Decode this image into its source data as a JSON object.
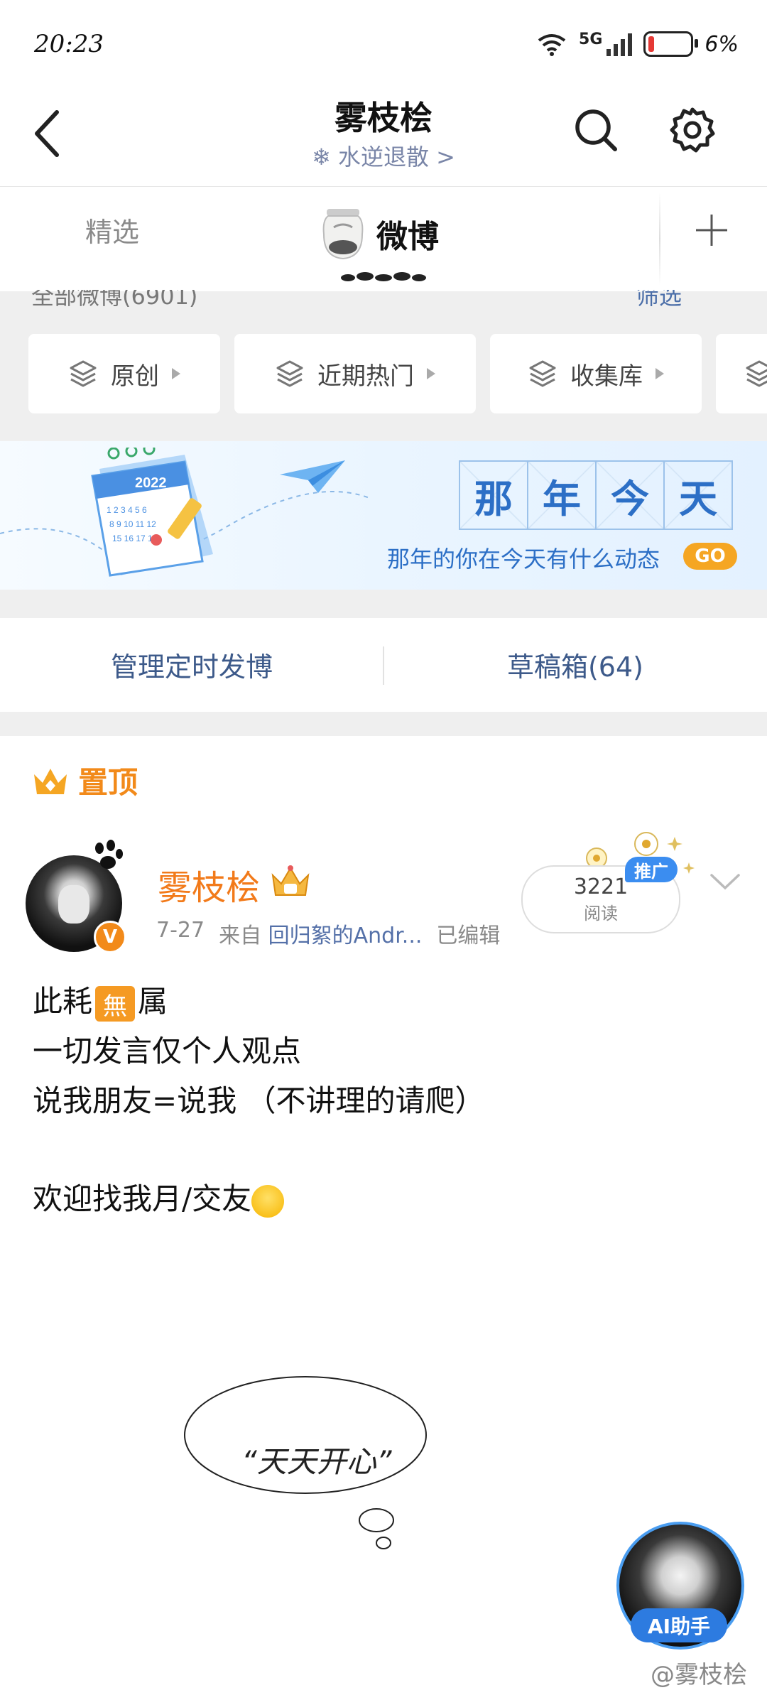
{
  "status": {
    "time": "20:23",
    "network": "5G",
    "battery": "6%",
    "battery_fraction": 0.06
  },
  "header": {
    "title": "雾枝桧",
    "subtitle": "❄ 水逆退散 >"
  },
  "tabs": [
    {
      "label": "精选",
      "selected": false
    },
    {
      "label": "微博",
      "selected": true
    }
  ],
  "filter": {
    "peek_left": "全部微博(6901)",
    "peek_right": "筛选"
  },
  "chips": [
    "原创",
    "近期热门",
    "收集库"
  ],
  "banner": {
    "title_chars": [
      "那",
      "年",
      "今",
      "天"
    ],
    "subtitle": "那年的你在今天有什么动态",
    "go": "GO",
    "calendar_year": "2022"
  },
  "manage": {
    "scheduled": "管理定时发博",
    "drafts": "草稿箱(64)"
  },
  "pinned": {
    "label": "置顶"
  },
  "post": {
    "author": "雾枝桧",
    "date": "7-27",
    "source_prefix": "来自",
    "source": "回归絮的Andr...",
    "edited": "已编辑",
    "read_count": "3221",
    "read_label": "阅读",
    "promo": "推广",
    "lines": {
      "l1a": "此耗",
      "l1b": "無",
      "l1c": "属",
      "l2": "一切发言仅个人观点",
      "l3": "说我朋友=说我  （不讲理的请爬）",
      "l4": "欢迎找我月/交友"
    },
    "doodle_text": "“天天开心”"
  },
  "ai": {
    "label": "AI助手"
  },
  "watermark": "@雾枝桧",
  "colors": {
    "accent_orange": "#f27a1a",
    "link_blue": "#3d5a8a",
    "banner_blue": "#2c6fc6",
    "ai_blue": "#2d7be0"
  }
}
